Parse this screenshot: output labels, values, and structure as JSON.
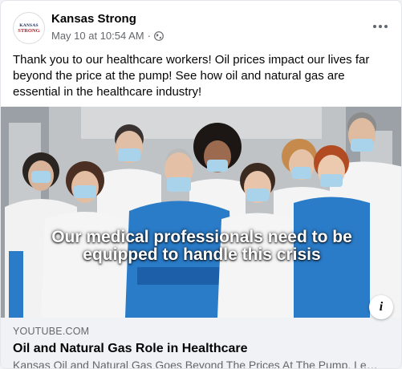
{
  "post": {
    "page_name": "Kansas Strong",
    "avatar_line1": "KANSAS",
    "avatar_line2": "STRONG",
    "date": "May 10 at 10:54 AM",
    "separator": "·",
    "audience_icon": "globe-icon",
    "more_icon": "more-dots-icon",
    "text": "Thank you to our healthcare workers! Oil prices impact our lives far beyond the price at the pump! See how oil and natural gas are essential in the healthcare industry!"
  },
  "media": {
    "caption_line1": "Our medical professionals need to be",
    "caption_line2": "equipped to handle this crisis",
    "info_icon": "info-icon",
    "info_label": "i"
  },
  "link": {
    "domain": "YOUTUBE.COM",
    "title": "Oil and Natural Gas Role in Healthcare",
    "description": "Kansas Oil and Natural Gas Goes Beyond The Prices At The Pump. Learn more"
  },
  "colors": {
    "scrub_blue": "#2a7bc8",
    "scrub_dark": "#1d5fa8",
    "mask": "#a9d3ea",
    "coat": "#f4f4f4",
    "text_secondary": "#65676b"
  }
}
